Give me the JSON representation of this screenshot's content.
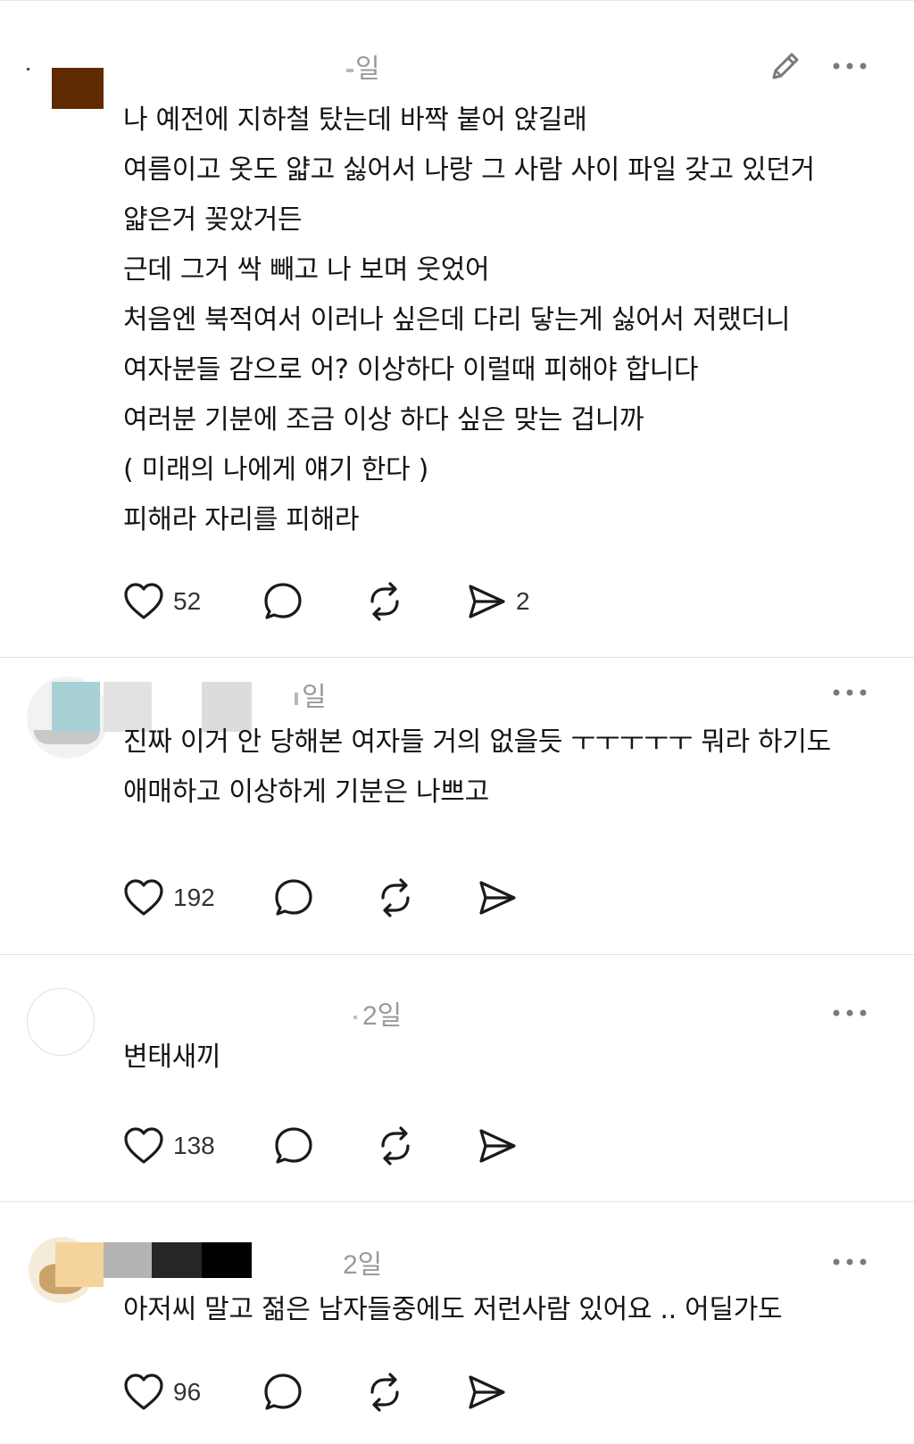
{
  "colors": {
    "text": "#141414",
    "muted": "#9a9a9a",
    "divider": "#e3e3e3"
  },
  "posts": [
    {
      "timestamp": "일",
      "has_edit": true,
      "body": "나 예전에 지하철 탔는데 바짝 붙어 앉길래\n여름이고 옷도 얇고 싫어서 나랑 그 사람 사이 파일 갖고 있던거\n얇은거 꽂았거든\n근데 그거 싹 빼고 나 보며 웃었어\n처음엔 북적여서 이러나 싶은데 다리 닿는게 싫어서 저랬더니\n여자분들 감으로 어? 이상하다 이럴때 피해야 합니다\n여러분 기분에 조금 이상 하다 싶은 맞는 겁니까\n( 미래의 나에게 얘기 한다 )\n피해라 자리를 피해라",
      "likes": "52",
      "shares": "2"
    },
    {
      "timestamp": "일",
      "body": "진짜 이거 안 당해본 여자들 거의 없을듯 ㅜㅜㅜㅜㅜ 뭐라 하기도\n애매하고 이상하게 기분은 나쁘고",
      "likes": "192",
      "shares": ""
    },
    {
      "timestamp": "2일",
      "body": "변태새끼",
      "likes": "138",
      "shares": ""
    },
    {
      "timestamp": "2일",
      "body": "아저씨 말고 젊은 남자들중에도 저런사람 있어요 .. 어딜가도",
      "likes": "96",
      "shares": ""
    }
  ],
  "icons": {
    "like": "heart-icon",
    "reply": "comment-bubble-icon",
    "repost": "repost-icon",
    "share": "send-icon",
    "more": "more-dots-icon",
    "edit": "pencil-icon"
  }
}
